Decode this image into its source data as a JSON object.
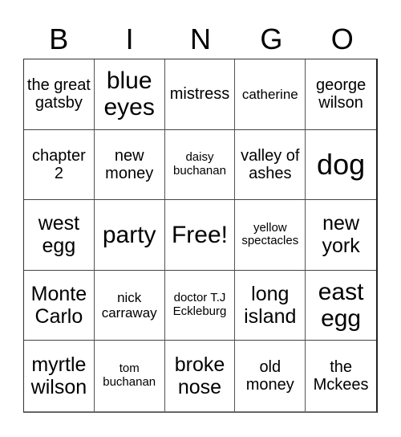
{
  "header": [
    "B",
    "I",
    "N",
    "G",
    "O"
  ],
  "cells": [
    {
      "text": "the great gatsby",
      "size": "m"
    },
    {
      "text": "blue eyes",
      "size": "xl"
    },
    {
      "text": "mistress",
      "size": "m"
    },
    {
      "text": "catherine",
      "size": "s"
    },
    {
      "text": "george wilson",
      "size": "m"
    },
    {
      "text": "chapter 2",
      "size": "m"
    },
    {
      "text": "new money",
      "size": "m"
    },
    {
      "text": "daisy buchanan",
      "size": "xs"
    },
    {
      "text": "valley of ashes",
      "size": "m"
    },
    {
      "text": "dog",
      "size": "xxl"
    },
    {
      "text": "west egg",
      "size": "l"
    },
    {
      "text": "party",
      "size": "xl"
    },
    {
      "text": "Free!",
      "size": "xl"
    },
    {
      "text": "yellow spectacles",
      "size": "xs"
    },
    {
      "text": "new york",
      "size": "l"
    },
    {
      "text": "Monte Carlo",
      "size": "l"
    },
    {
      "text": "nick carraway",
      "size": "s"
    },
    {
      "text": "doctor T.J Eckleburg",
      "size": "xs"
    },
    {
      "text": "long island",
      "size": "l"
    },
    {
      "text": "east egg",
      "size": "xl"
    },
    {
      "text": "myrtle wilson",
      "size": "l"
    },
    {
      "text": "tom buchanan",
      "size": "xs"
    },
    {
      "text": "broke nose",
      "size": "l"
    },
    {
      "text": "old money",
      "size": "m"
    },
    {
      "text": "the Mckees",
      "size": "m"
    }
  ]
}
